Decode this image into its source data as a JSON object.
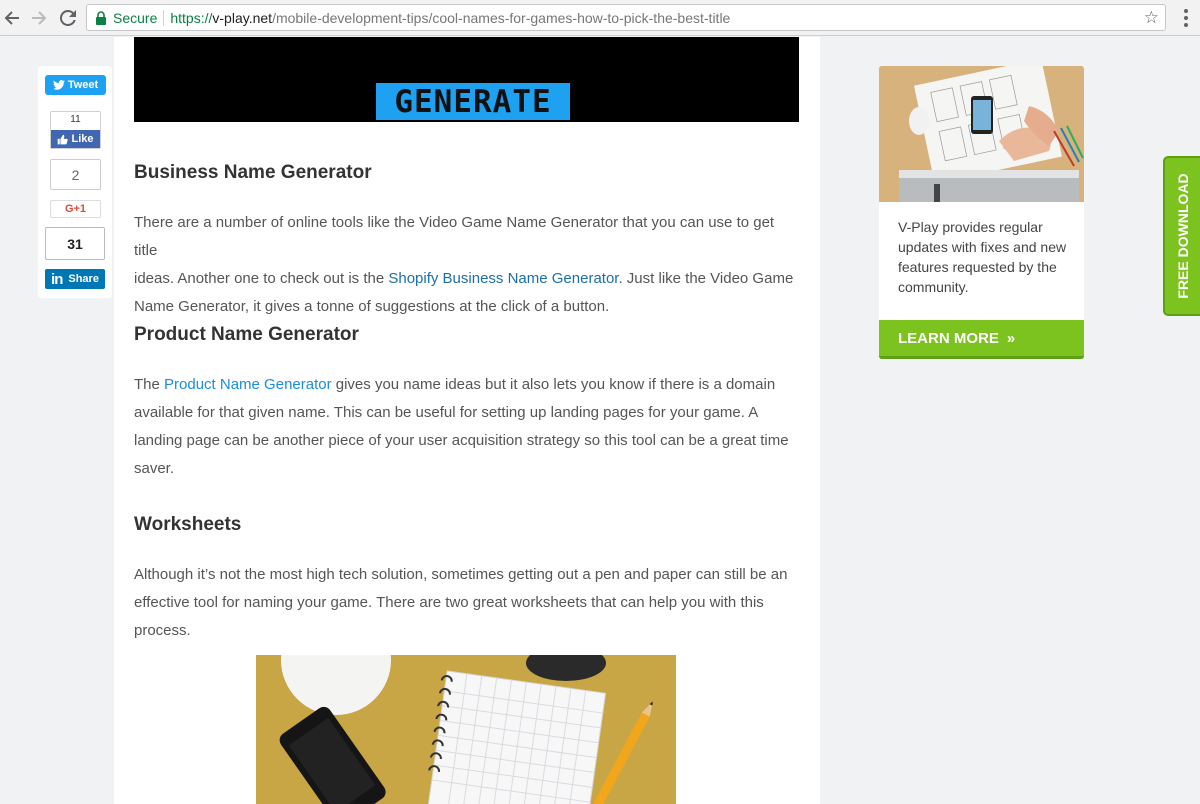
{
  "browser": {
    "secure_label": "Secure",
    "url_scheme": "https://",
    "url_host": "v-play.net",
    "url_path": "/mobile-development-tips/cool-names-for-games-how-to-pick-the-best-title"
  },
  "social": {
    "tweet_label": "Tweet",
    "fb_count": "11",
    "fb_label": "Like",
    "gplus_count": "2",
    "gplus_label": "G+1",
    "linkedin_count": "31",
    "linkedin_label": "Share"
  },
  "hero": {
    "generate_label": "GENERATE"
  },
  "article": {
    "sections": [
      {
        "heading": "Business Name Generator",
        "lines": [
          {
            "pre": "There are a number of online tools like the Video Game Name Generator that you can use to get title",
            "link": "",
            "post": ""
          },
          {
            "pre": "ideas. Another one to check out is the ",
            "link": "Shopify Business Name Generator",
            "post": ". Just like the Video Game"
          },
          {
            "pre": "Name Generator, it gives a tonne of suggestions at the click of a button.",
            "link": "",
            "post": ""
          }
        ]
      },
      {
        "heading": "Product Name Generator",
        "lines": [
          {
            "pre": "The ",
            "link": "Product Name Generator",
            "post": " gives you name ideas but it also lets you know if there is a domain"
          },
          {
            "pre": "available for that given name. This can be useful for setting up landing pages for your game. A",
            "link": "",
            "post": ""
          },
          {
            "pre": "landing page can be another piece of your user acquisition strategy so this tool can be a great time",
            "link": "",
            "post": ""
          },
          {
            "pre": "saver.",
            "link": "",
            "post": ""
          }
        ]
      },
      {
        "heading": "Worksheets",
        "lines": [
          {
            "pre": "Although it’s not the most high tech solution, sometimes getting out a pen and paper can still be an",
            "link": "",
            "post": ""
          },
          {
            "pre": "effective tool for naming your game. There are two great worksheets that can help you with this",
            "link": "",
            "post": ""
          },
          {
            "pre": "process.",
            "link": "",
            "post": ""
          }
        ]
      }
    ]
  },
  "sidebar_ad": {
    "text": "V-Play provides regular updates with fixes and new features requested by the community.",
    "button_label": "LEARN MORE"
  },
  "free_download": {
    "label": "FREE DOWNLOAD"
  },
  "colors": {
    "accent_green": "#7cc31f",
    "link_blue": "#1a8fd8",
    "tweet_blue": "#1da1f2",
    "facebook_blue": "#4267b2",
    "linkedin_blue": "#0077b5"
  }
}
